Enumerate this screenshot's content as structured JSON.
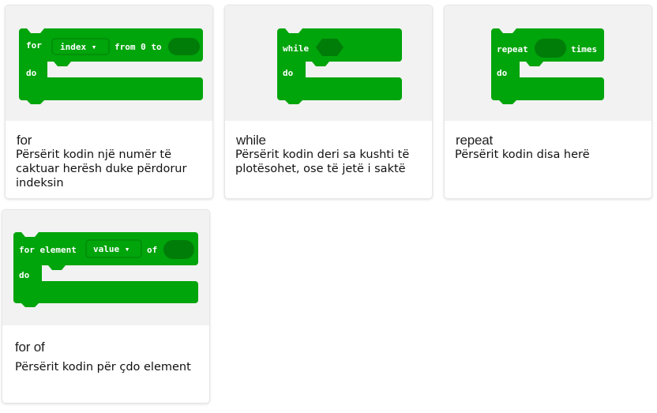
{
  "colors": {
    "block_green": "#00a40b",
    "block_dark": "#008b09",
    "slot_dark": "#007d08"
  },
  "cards": [
    {
      "title": "for",
      "description": "Përsërit kodin një numër të caktuar herësh duke përdorur indeksin",
      "block": {
        "kw_for": "for",
        "var": "index ▾",
        "kw_from": "from 0 to",
        "kw_do": "do"
      }
    },
    {
      "title": "while",
      "description": "Përsërit kodin deri sa kushti të plotësohet, ose të jetë i saktë",
      "block": {
        "kw_while": "while",
        "kw_do": "do"
      }
    },
    {
      "title": "repeat",
      "description": "Përsërit kodin disa herë",
      "block": {
        "kw_repeat": "repeat",
        "kw_times": "times",
        "kw_do": "do"
      }
    },
    {
      "title": "for of",
      "description": "Përsërit kodin për çdo element",
      "block": {
        "kw_for": "for element",
        "var": "value ▾",
        "kw_of": "of",
        "kw_do": "do"
      }
    }
  ]
}
